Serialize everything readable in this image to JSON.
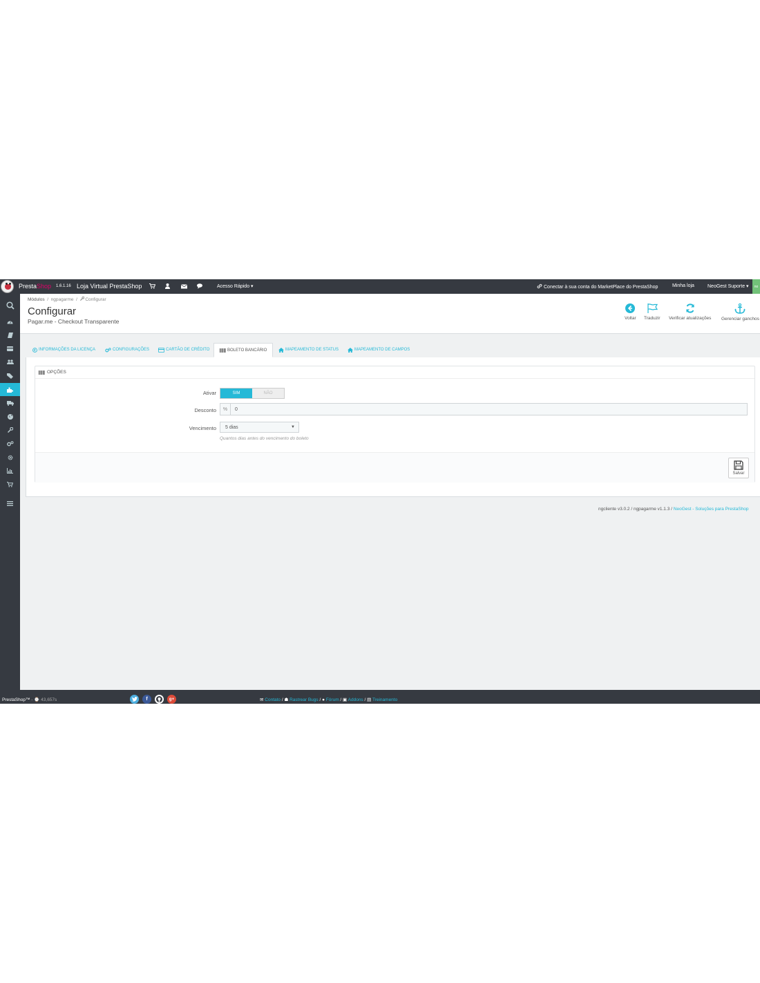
{
  "topbar": {
    "brand_presta": "Presta",
    "brand_shop": "Shop",
    "version": "1.6.1.16",
    "store_name": "Loja Virtual PrestaShop",
    "quick_access": "Acesso Rápido",
    "marketplace": "Conectar à sua conta do MarketPlace do PrestaShop",
    "my_store": "Minha loja",
    "user": "NeoGest Suporte",
    "green_tag": "no"
  },
  "breadcrumb": {
    "modules": "Módulos",
    "module": "ngpagarme",
    "current": "Configurar"
  },
  "header": {
    "title": "Configurar",
    "subtitle": "Pagar.me - Checkout Transparente",
    "toolbar": {
      "back": "Voltar",
      "translate": "Traduzir",
      "check_updates": "Verificar atualizações",
      "manage_hooks": "Gerenciar ganchos"
    }
  },
  "tabs": [
    {
      "label": "Informações da Licença"
    },
    {
      "label": "Configurações"
    },
    {
      "label": "Cartão de Crédito"
    },
    {
      "label": "Boleto Bancário"
    },
    {
      "label": "Mapeamento de Status"
    },
    {
      "label": "Mapeamento de Campos"
    }
  ],
  "panel": {
    "title": "Opções",
    "fields": {
      "ativar_label": "Ativar",
      "ativar_yes": "SIM",
      "ativar_no": "NÃO",
      "desconto_label": "Desconto",
      "desconto_addon": "%",
      "desconto_value": "0",
      "vencimento_label": "Vencimento",
      "vencimento_value": "5 dias",
      "vencimento_help": "Quantos dias antes do vencimento do boleto"
    },
    "save": "Salvar"
  },
  "version_line": {
    "text": "ngcliente v3.0.2 / ngpagarme v1.1.3 /",
    "link": "NeoGest - Soluções para PrestaShop"
  },
  "footer": {
    "brand": "PrestaShop™",
    "timing": "43,657s",
    "links": {
      "contact": "Contato",
      "bugs": "Rastrear Bugs",
      "forum": "Fórum",
      "addons": "Addons",
      "training": "Treinamento"
    },
    "social_colors": {
      "twitter": "#4dafe0",
      "facebook": "#3b5998",
      "github": "#ffffff",
      "google": "#dd4b39"
    }
  },
  "colors": {
    "accent": "#25b9d7",
    "topbar_bg": "#363a41",
    "page_bg": "#eff1f2",
    "brand_pink": "#df0067"
  }
}
